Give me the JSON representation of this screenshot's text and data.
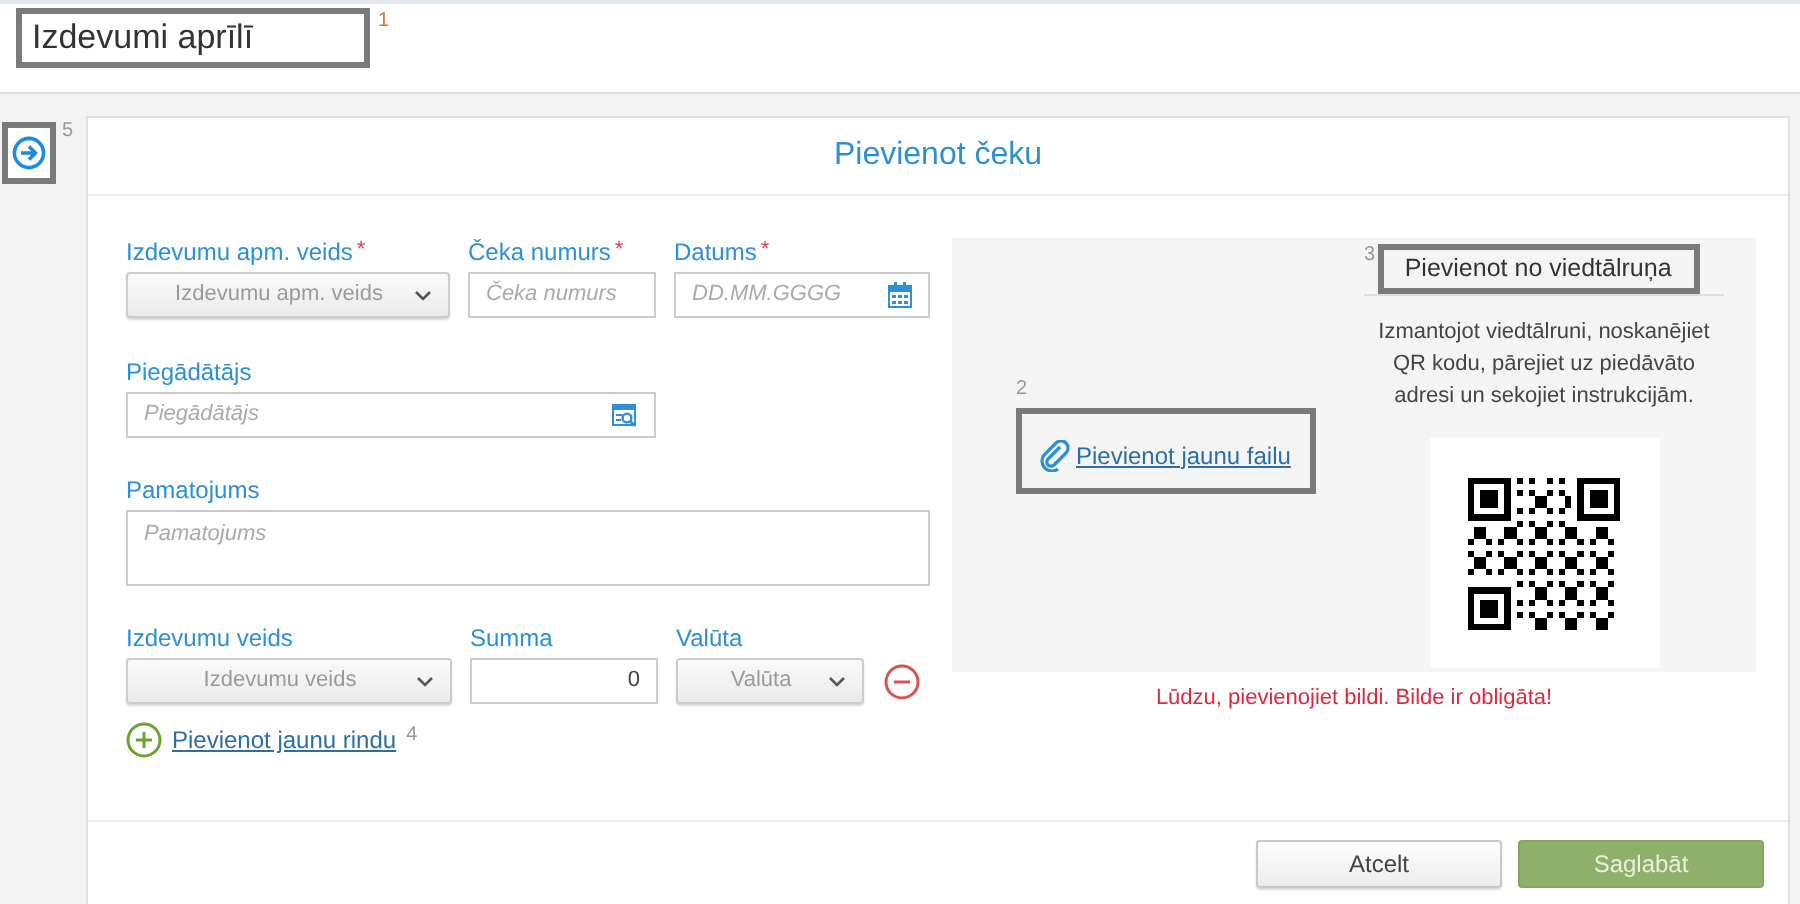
{
  "page_title": {
    "text": "Izdevumi aprīlī",
    "marker": "1"
  },
  "side_toggle": {
    "marker": "5"
  },
  "dialog": {
    "title": "Pievienot čeku",
    "required_mark": "*",
    "top_row": [
      {
        "label": "Izdevumu apm. veids",
        "required": true,
        "kind": "select",
        "placeholder": "Izdevumu apm. veids"
      },
      {
        "label": "Čeka numurs",
        "required": true,
        "kind": "text",
        "placeholder": "Čeka numurs"
      },
      {
        "label": "Datums",
        "required": true,
        "kind": "date",
        "placeholder": "DD.MM.GGGG"
      }
    ],
    "supplier": {
      "label": "Piegādātājs",
      "placeholder": "Piegādātājs"
    },
    "justification": {
      "label": "Pamatojums",
      "placeholder": "Pamatojums"
    },
    "line_items": {
      "columns": [
        "Izdevumu veids",
        "Summa",
        "Valūta"
      ],
      "rows": [
        {
          "type_placeholder": "Izdevumu veids",
          "amount": "0",
          "currency_placeholder": "Valūta"
        }
      ]
    },
    "add_row": {
      "label": "Pievienot jaunu rindu",
      "marker": "4"
    },
    "attachment": {
      "upload_link": "Pievienot jaunu failu",
      "upload_marker": "2",
      "phone_title": "Pievienot no viedtālruņa",
      "phone_marker": "3",
      "instructions": "Izmantojot viedtālruni, noskanējiet QR kodu, pārejiet uz piedāvāto adresi un sekojiet instrukcijām.",
      "error": "Lūdzu, pievienojiet bildi. Bilde ir obligāta!"
    },
    "buttons": [
      {
        "label": "Atcelt",
        "kind": "secondary"
      },
      {
        "label": "Saglabāt",
        "kind": "primary"
      }
    ]
  }
}
